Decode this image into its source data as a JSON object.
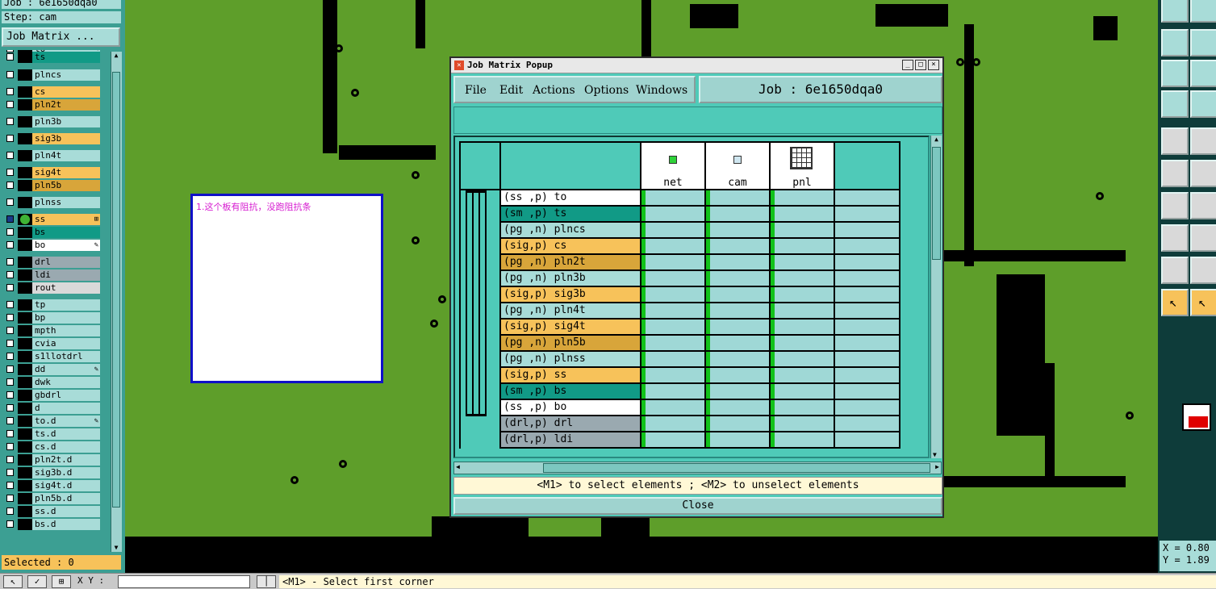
{
  "left_panel": {
    "job_label": "Job : 6e1650dqa0",
    "step_label": "Step: cam",
    "job_matrix_button": "Job Matrix ...",
    "selected": "Selected : 0",
    "layers": [
      {
        "name": "to",
        "color": "#a8dcd8",
        "mark": "✎"
      },
      {
        "name": "ts",
        "color": "#119a86"
      },
      {
        "name": "plncs",
        "color": "#a8dcd8"
      },
      {
        "name": "cs",
        "color": "#f7c25a"
      },
      {
        "name": "pln2t",
        "color": "#d8a53a"
      },
      {
        "name": "pln3b",
        "color": "#a8dcd8"
      },
      {
        "name": "sig3b",
        "color": "#f7c25a"
      },
      {
        "name": "pln4t",
        "color": "#a8dcd8"
      },
      {
        "name": "sig4t",
        "color": "#f7c25a"
      },
      {
        "name": "pln5b",
        "color": "#d8a53a"
      },
      {
        "name": "plnss",
        "color": "#a8dcd8"
      },
      {
        "name": "ss",
        "color": "#f7c25a",
        "active": true,
        "mark": "⊞"
      },
      {
        "name": "bs",
        "color": "#119a86"
      },
      {
        "name": "bo",
        "color": "#ffffff",
        "mark": "✎"
      },
      {
        "name": "drl",
        "color": "#9aa9b0"
      },
      {
        "name": "ldi",
        "color": "#9aa9b0"
      },
      {
        "name": "rout",
        "color": "#d9d9d9"
      },
      {
        "name": "tp",
        "color": "#a8dcd8"
      },
      {
        "name": "bp",
        "color": "#a8dcd8"
      },
      {
        "name": "mpth",
        "color": "#a8dcd8"
      },
      {
        "name": "cvia",
        "color": "#a8dcd8"
      },
      {
        "name": "s1llotdrl",
        "color": "#a8dcd8"
      },
      {
        "name": "dd",
        "color": "#a8dcd8",
        "mark": "✎"
      },
      {
        "name": "dwk",
        "color": "#a8dcd8"
      },
      {
        "name": "gbdrl",
        "color": "#a8dcd8"
      },
      {
        "name": "d",
        "color": "#a8dcd8"
      },
      {
        "name": "to.d",
        "color": "#a8dcd8",
        "mark": "✎"
      },
      {
        "name": "ts.d",
        "color": "#a8dcd8"
      },
      {
        "name": "cs.d",
        "color": "#a8dcd8"
      },
      {
        "name": "pln2t.d",
        "color": "#a8dcd8"
      },
      {
        "name": "sig3b.d",
        "color": "#a8dcd8"
      },
      {
        "name": "sig4t.d",
        "color": "#a8dcd8"
      },
      {
        "name": "pln5b.d",
        "color": "#a8dcd8"
      },
      {
        "name": "ss.d",
        "color": "#a8dcd8"
      },
      {
        "name": "bs.d",
        "color": "#a8dcd8"
      }
    ]
  },
  "note": {
    "text": "1.这个板有阻抗，没跑阻抗条"
  },
  "popup": {
    "title": "Job Matrix Popup",
    "menus": [
      "File",
      "Edit",
      "Actions",
      "Options",
      "Windows"
    ],
    "job_title": "Job : 6e1650dqa0",
    "steps": [
      {
        "name": "net",
        "icon": "net-icon"
      },
      {
        "name": "cam",
        "icon": "cam-icon"
      },
      {
        "name": "pnl",
        "icon": "panel-grid-icon"
      }
    ],
    "rows": [
      {
        "label": "(ss ,p) to",
        "color": "#ffffff"
      },
      {
        "label": "(sm ,p) ts",
        "color": "#119a86"
      },
      {
        "label": "(pg ,n) plncs",
        "color": "#a8dcd8"
      },
      {
        "label": "(sig,p) cs",
        "color": "#f7c25a"
      },
      {
        "label": "(pg ,n) pln2t",
        "color": "#d8a53a"
      },
      {
        "label": "(pg ,n) pln3b",
        "color": "#a8dcd8"
      },
      {
        "label": "(sig,p) sig3b",
        "color": "#f7c25a"
      },
      {
        "label": "(pg ,n) pln4t",
        "color": "#a8dcd8"
      },
      {
        "label": "(sig,p) sig4t",
        "color": "#f7c25a"
      },
      {
        "label": "(pg ,n) pln5b",
        "color": "#d8a53a"
      },
      {
        "label": "(pg ,n) plnss",
        "color": "#a8dcd8"
      },
      {
        "label": "(sig,p) ss",
        "color": "#f7c25a"
      },
      {
        "label": "(sm ,p) bs",
        "color": "#119a86"
      },
      {
        "label": "(ss ,p) bo",
        "color": "#ffffff"
      },
      {
        "label": "(drl,p) drl",
        "color": "#9aa9b0"
      },
      {
        "label": "(drl,p) ldi",
        "color": "#9aa9b0"
      }
    ],
    "status": "<M1> to select elements ; <M2> to unselect elements",
    "close_label": "Close"
  },
  "right_panel": {
    "x_label": "X = 0.80",
    "y_label": "Y = 1.89"
  },
  "bottom": {
    "xy_label": "X Y :",
    "hint": "<M1> - Select first corner"
  }
}
